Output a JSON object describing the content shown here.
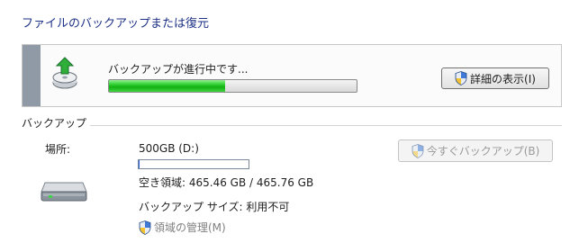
{
  "page": {
    "title": "ファイルのバックアップまたは復元"
  },
  "progress": {
    "status": "バックアップが進行中です...",
    "progress_fraction": 0.47,
    "details_button": "詳細の表示(I)"
  },
  "backup": {
    "section_label": "バックアップ",
    "location_label": "場所:",
    "drive_name": "500GB (D:)",
    "drive_used_fraction": 0.005,
    "free_space": "空き領域: 465.46 GB / 465.76 GB",
    "backup_size": "バックアップ サイズ: 利用不可",
    "manage_space_link": "領域の管理(M)",
    "backup_now_button": "今すぐバックアップ(B)"
  },
  "icons": {
    "backup_animation": "backup-progress-icon",
    "drive": "hard-drive-icon",
    "uac_shield": "uac-shield-icon"
  },
  "colors": {
    "title": "#1e3287",
    "progress_green": "#14b014",
    "panel_accent": "#8f9aa6"
  }
}
